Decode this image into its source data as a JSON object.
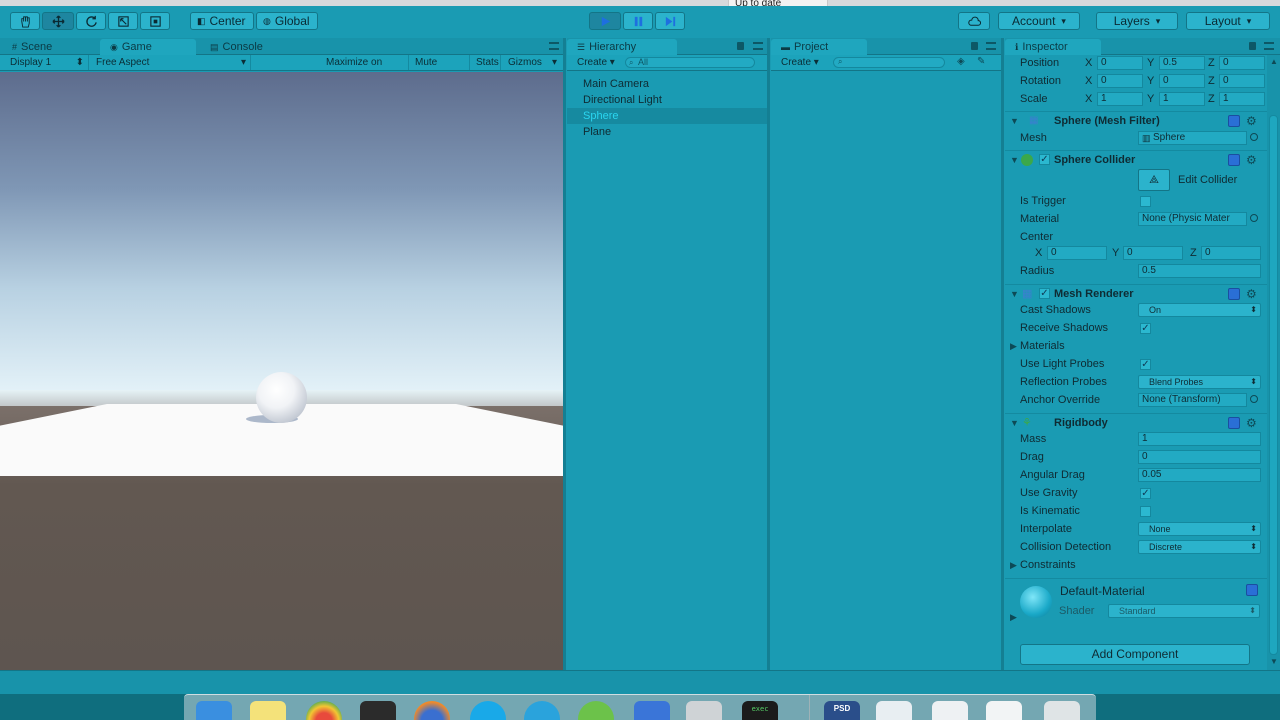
{
  "notification": {
    "text": "Up to date"
  },
  "toolbar": {
    "pivot_label": "Center",
    "space_label": "Global",
    "account_label": "Account",
    "layers_label": "Layers",
    "layout_label": "Layout"
  },
  "scene_panel": {
    "tabs": [
      {
        "label": "Scene"
      },
      {
        "label": "Game"
      },
      {
        "label": "Console"
      }
    ],
    "display": "Display 1",
    "aspect": "Free Aspect",
    "maximize": "Maximize on Play",
    "mute": "Mute audio",
    "stats": "Stats",
    "gizmos": "Gizmos"
  },
  "hierarchy": {
    "title": "Hierarchy",
    "create": "Create",
    "search_placeholder": "All",
    "items": [
      {
        "label": "Main Camera"
      },
      {
        "label": "Directional Light"
      },
      {
        "label": "Sphere"
      },
      {
        "label": "Plane"
      }
    ]
  },
  "project": {
    "title": "Project",
    "create": "Create"
  },
  "inspector": {
    "title": "Inspector",
    "transform": {
      "position": {
        "label": "Position",
        "x": "0",
        "y": "0.5",
        "z": "0"
      },
      "rotation": {
        "label": "Rotation",
        "x": "0",
        "y": "0",
        "z": "0"
      },
      "scale": {
        "label": "Scale",
        "x": "1",
        "y": "1",
        "z": "1"
      }
    },
    "mesh_filter": {
      "title": "Sphere (Mesh Filter)",
      "mesh_label": "Mesh",
      "mesh_value": "Sphere"
    },
    "sphere_collider": {
      "title": "Sphere Collider",
      "edit_label": "Edit Collider",
      "is_trigger": "Is Trigger",
      "material_label": "Material",
      "material_value": "None (Physic Mater",
      "center_label": "Center",
      "center": {
        "x": "0",
        "y": "0",
        "z": "0"
      },
      "radius_label": "Radius",
      "radius_value": "0.5"
    },
    "mesh_renderer": {
      "title": "Mesh Renderer",
      "cast_shadows": "Cast Shadows",
      "cast_shadows_value": "On",
      "receive_shadows": "Receive Shadows",
      "materials": "Materials",
      "use_light_probes": "Use Light Probes",
      "reflection_probes": "Reflection Probes",
      "reflection_probes_value": "Blend Probes",
      "anchor_override": "Anchor Override",
      "anchor_override_value": "None (Transform)"
    },
    "rigidbody": {
      "title": "Rigidbody",
      "mass": "Mass",
      "mass_value": "1",
      "drag": "Drag",
      "drag_value": "0",
      "angular_drag": "Angular Drag",
      "angular_drag_value": "0.05",
      "use_gravity": "Use Gravity",
      "is_kinematic": "Is Kinematic",
      "interpolate": "Interpolate",
      "interpolate_value": "None",
      "collision_detection": "Collision Detection",
      "collision_detection_value": "Discrete",
      "constraints": "Constraints"
    },
    "material": {
      "name": "Default-Material",
      "shader_label": "Shader",
      "shader_value": "Standard"
    },
    "add_component": "Add Component"
  },
  "axis_labels": {
    "x": "X",
    "y": "Y",
    "z": "Z"
  },
  "dock": {
    "psd_label": "PSD",
    "exec_label": "exec"
  }
}
